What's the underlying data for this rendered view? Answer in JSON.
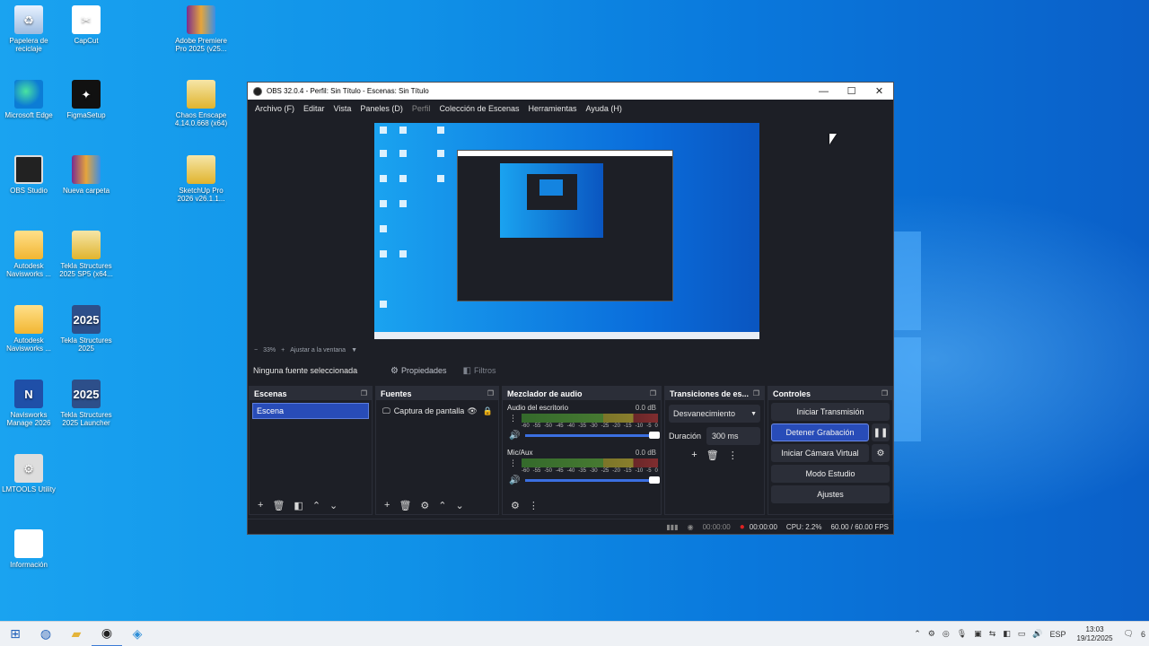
{
  "desktop": {
    "icons": [
      {
        "label": "Papelera de reciclaje",
        "icon": "recycle-bin-icon"
      },
      {
        "label": "CapCut",
        "icon": "capcut-icon"
      },
      {
        "label": "Adobe Premiere Pro 2025 (v25...",
        "icon": "archive-icon"
      },
      {
        "label": "Microsoft Edge",
        "icon": "edge-icon"
      },
      {
        "label": "FigmaSetup",
        "icon": "figma-icon"
      },
      {
        "label": "Chaos Enscape 4.14.0.668 (x64)",
        "icon": "archive-icon"
      },
      {
        "label": "OBS Studio",
        "icon": "obs-icon"
      },
      {
        "label": "Nueva carpeta",
        "icon": "folder-icon"
      },
      {
        "label": "SketchUp Pro 2026 v26.1.1...",
        "icon": "archive-icon"
      },
      {
        "label": "Autodesk Navisworks ...",
        "icon": "folder-icon"
      },
      {
        "label": "Tekla Structures 2025 SP5 (x64...",
        "icon": "archive-icon"
      },
      {
        "label": "Autodesk Navisworks ...",
        "icon": "folder-icon"
      },
      {
        "label": "Tekla Structures 2025",
        "icon": "tekla-icon"
      },
      {
        "label": "Navisworks Manage 2026",
        "icon": "navisworks-icon"
      },
      {
        "label": "Tekla Structures 2025 Launcher",
        "icon": "tekla-icon"
      },
      {
        "label": "LMTOOLS Utility",
        "icon": "lmtools-icon"
      },
      {
        "label": "Información",
        "icon": "document-icon"
      }
    ]
  },
  "obs": {
    "title": "OBS 32.0.4 - Perfil: Sin Título - Escenas: Sin Título",
    "window_buttons": {
      "minimize": "—",
      "maximize": "☐",
      "close": "✕"
    },
    "menu": [
      {
        "label": "Archivo (F)",
        "enabled": true
      },
      {
        "label": "Editar",
        "enabled": true
      },
      {
        "label": "Vista",
        "enabled": true
      },
      {
        "label": "Paneles (D)",
        "enabled": true
      },
      {
        "label": "Perfil",
        "enabled": false
      },
      {
        "label": "Colección de Escenas",
        "enabled": true
      },
      {
        "label": "Herramientas",
        "enabled": true
      },
      {
        "label": "Ayuda (H)",
        "enabled": true
      }
    ],
    "zoom": {
      "minus": "−",
      "value": "33%",
      "plus": "+",
      "fit_label": "Ajustar a la ventana",
      "arrow": "▼"
    },
    "source_bar": {
      "no_source": "Ninguna fuente seleccionada",
      "properties": "Propiedades",
      "filters": "Filtros"
    },
    "scenes": {
      "title": "Escenas",
      "items": [
        "Escena"
      ]
    },
    "sources": {
      "title": "Fuentes",
      "items": [
        "Captura de pantalla"
      ]
    },
    "mixer": {
      "title": "Mezclador de audio",
      "channels": [
        {
          "name": "Audio del escritorio",
          "db": "0.0 dB",
          "level": 0.82
        },
        {
          "name": "Mic/Aux",
          "db": "0.0 dB",
          "level": 0.82
        }
      ],
      "ticks": [
        "-60",
        "-55",
        "-50",
        "-45",
        "-40",
        "-35",
        "-30",
        "-25",
        "-20",
        "-15",
        "-10",
        "-5",
        "0"
      ]
    },
    "transitions": {
      "title": "Transiciones de es...",
      "selected": "Desvanecimiento",
      "duration_label": "Duración",
      "duration_value": "300 ms"
    },
    "controls": {
      "title": "Controles",
      "start_stream": "Iniciar Transmisión",
      "stop_recording": "Detener Grabación",
      "start_virtual_cam": "Iniciar Cámara Virtual",
      "studio_mode": "Modo Estudio",
      "settings": "Ajustes"
    },
    "status": {
      "stream_time": "00:00:00",
      "rec_time": "00:00:00",
      "cpu": "CPU: 2.2%",
      "fps": "60.00 / 60.00 FPS"
    }
  },
  "taskbar": {
    "lang": "ESP",
    "time": "13:03",
    "date": "19/12/2025",
    "notifications": "6"
  }
}
